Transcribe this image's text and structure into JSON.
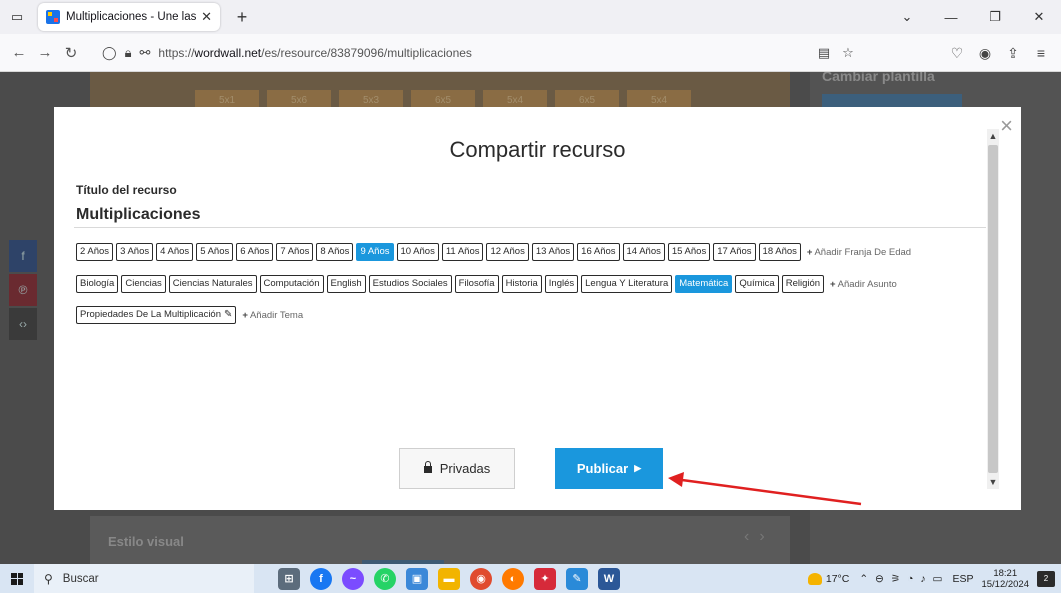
{
  "browser": {
    "tab_title": "Multiplicaciones - Une las pare",
    "tab_close": "✕",
    "new_tab": "+",
    "url_prefix": "https://",
    "url_domain": "wordwall.net",
    "url_path": "/es/resource/83879096/multiplicaciones"
  },
  "background": {
    "right_panel_title": "Cambiar plantilla",
    "board_cells": [
      "5x1",
      "5x6",
      "5x3",
      "6x5",
      "5x4",
      "6x5",
      "5x4"
    ],
    "bottom_panel_title": "Estilo visual"
  },
  "modal": {
    "title": "Compartir recurso",
    "close": "×",
    "title_label": "Título del recurso",
    "title_value": "Multiplicaciones",
    "age_tags": [
      "2 Años",
      "3 Años",
      "4 Años",
      "5 Años",
      "6 Años",
      "7 Años",
      "8 Años",
      "9 Años",
      "10 Años",
      "11 Años",
      "12 Años",
      "13 Años",
      "16 Años",
      "14 Años",
      "15 Años",
      "17 Años",
      "18 Años"
    ],
    "age_selected": "9 Años",
    "add_age": "Añadir Franja De Edad",
    "subject_tags": [
      "Biología",
      "Ciencias",
      "Ciencias Naturales",
      "Computación",
      "English",
      "Estudios Sociales",
      "Filosofía",
      "Historia",
      "Inglés",
      "Lengua Y Literatura",
      "Matemática",
      "Química",
      "Religión"
    ],
    "subject_selected": "Matemática",
    "add_subject": "Añadir Asunto",
    "topic_tag": "Propiedades De La Multiplicación",
    "add_topic": "Añadir Tema",
    "private_label": "Privadas",
    "publish_label": "Publicar"
  },
  "colors": {
    "accent": "#1a97dd",
    "annotation_arrow": "#e02020"
  },
  "taskbar": {
    "search_label": "Buscar",
    "weather": "17°C",
    "language": "ESP",
    "time": "18:21",
    "date": "15/12/2024",
    "notifications": "2"
  }
}
